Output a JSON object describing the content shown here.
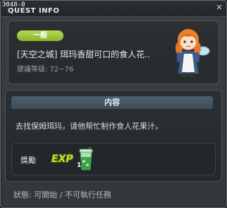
{
  "window": {
    "quest_id": "3048-0",
    "title": "QUEST INFO",
    "close_glyph": "✕"
  },
  "quest": {
    "category": "一般",
    "name": "[天空之城] 珥玛香甜可口的食人花..",
    "level": "建議等级: 72~76"
  },
  "content": {
    "header": "内容",
    "description": "去找保姆珥玛，请他帮忙制作食人花果汁。",
    "reward_label": "獎勵",
    "exp_text": "EXP",
    "item_quantity": "1"
  },
  "status": {
    "text": "狀態: 可開始 / 不可執行任務"
  },
  "icons": {
    "npc": "npc-nanny-icon",
    "exp": "exp-icon",
    "item": "juice-bottle-icon"
  },
  "colors": {
    "badge": "#8ab52a",
    "section_header": "#4c5e6e",
    "exp": "#c6e02a"
  }
}
